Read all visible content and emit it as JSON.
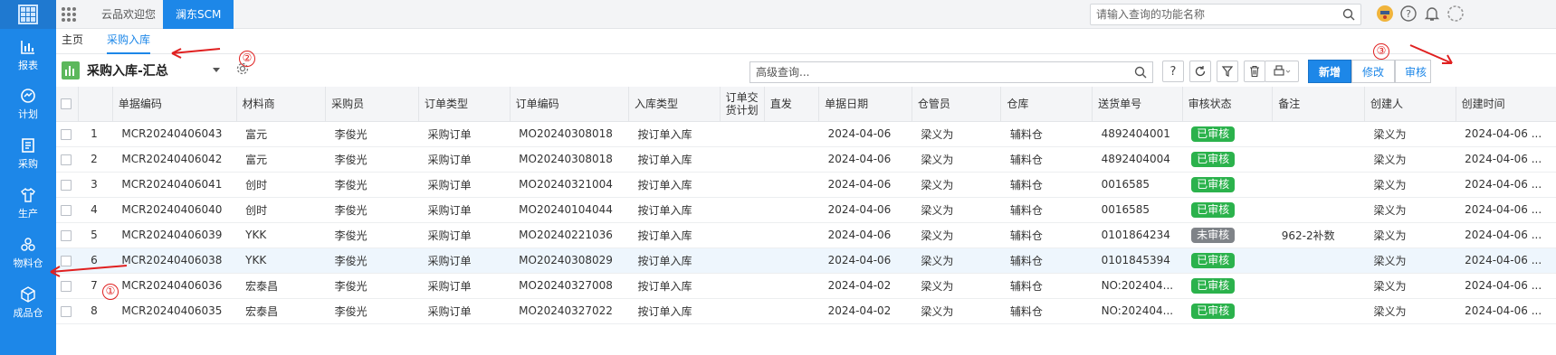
{
  "topbar": {
    "tabs": [
      "云品欢迎您",
      "澜东SCM"
    ],
    "search_placeholder": "请输入查询的功能名称",
    "icons": [
      "apps-grid-icon",
      "avatar-icon",
      "help-icon",
      "bell-icon",
      "user-loading-icon"
    ]
  },
  "sidebar": {
    "items": [
      {
        "label": "报表",
        "icon": "bar-chart-icon"
      },
      {
        "label": "计划",
        "icon": "plan-icon"
      },
      {
        "label": "采购",
        "icon": "purchase-icon"
      },
      {
        "label": "生产",
        "icon": "shirt-icon"
      },
      {
        "label": "物料仓",
        "icon": "materials-icon"
      },
      {
        "label": "成品仓",
        "icon": "box-icon"
      }
    ]
  },
  "page_tabs": [
    "主页",
    "采购入库"
  ],
  "toolbar": {
    "title": "采购入库-汇总",
    "search_placeholder": "高级查询...",
    "help_label": "?",
    "new_label": "新增",
    "edit_label": "修改",
    "audit_label": "审核"
  },
  "table": {
    "columns": [
      "单据编码",
      "材料商",
      "采购员",
      "订单类型",
      "订单编码",
      "入库类型",
      "订单交货计划",
      "直发",
      "单据日期",
      "仓管员",
      "仓库",
      "送货单号",
      "审核状态",
      "备注",
      "创建人",
      "创建时间"
    ],
    "rows": [
      {
        "no": "1",
        "code": "MCR20240406043",
        "supplier": "富元",
        "buyer": "李俊光",
        "order_type": "采购订单",
        "order_code": "MO20240308018",
        "in_type": "按订单入库",
        "plan": "",
        "direct": "",
        "date": "2024-04-06",
        "keeper": "梁义为",
        "warehouse": "辅料仓",
        "delivery": "4892404001",
        "status": "已审核",
        "status_ok": true,
        "remark": "",
        "creator": "梁义为",
        "created": "2024-04-06 ..."
      },
      {
        "no": "2",
        "code": "MCR20240406042",
        "supplier": "富元",
        "buyer": "李俊光",
        "order_type": "采购订单",
        "order_code": "MO20240308018",
        "in_type": "按订单入库",
        "plan": "",
        "direct": "",
        "date": "2024-04-06",
        "keeper": "梁义为",
        "warehouse": "辅料仓",
        "delivery": "4892404004",
        "status": "已审核",
        "status_ok": true,
        "remark": "",
        "creator": "梁义为",
        "created": "2024-04-06 ..."
      },
      {
        "no": "3",
        "code": "MCR20240406041",
        "supplier": "创时",
        "buyer": "李俊光",
        "order_type": "采购订单",
        "order_code": "MO20240321004",
        "in_type": "按订单入库",
        "plan": "",
        "direct": "",
        "date": "2024-04-06",
        "keeper": "梁义为",
        "warehouse": "辅料仓",
        "delivery": "0016585",
        "status": "已审核",
        "status_ok": true,
        "remark": "",
        "creator": "梁义为",
        "created": "2024-04-06 ..."
      },
      {
        "no": "4",
        "code": "MCR20240406040",
        "supplier": "创时",
        "buyer": "李俊光",
        "order_type": "采购订单",
        "order_code": "MO20240104044",
        "in_type": "按订单入库",
        "plan": "",
        "direct": "",
        "date": "2024-04-06",
        "keeper": "梁义为",
        "warehouse": "辅料仓",
        "delivery": "0016585",
        "status": "已审核",
        "status_ok": true,
        "remark": "",
        "creator": "梁义为",
        "created": "2024-04-06 ..."
      },
      {
        "no": "5",
        "code": "MCR20240406039",
        "supplier": "YKK",
        "buyer": "李俊光",
        "order_type": "采购订单",
        "order_code": "MO20240221036",
        "in_type": "按订单入库",
        "plan": "",
        "direct": "",
        "date": "2024-04-06",
        "keeper": "梁义为",
        "warehouse": "辅料仓",
        "delivery": "0101864234",
        "status": "未审核",
        "status_ok": false,
        "remark": "962-2补数",
        "creator": "梁义为",
        "created": "2024-04-06 ..."
      },
      {
        "no": "6",
        "code": "MCR20240406038",
        "supplier": "YKK",
        "buyer": "李俊光",
        "order_type": "采购订单",
        "order_code": "MO20240308029",
        "in_type": "按订单入库",
        "plan": "",
        "direct": "",
        "date": "2024-04-06",
        "keeper": "梁义为",
        "warehouse": "辅料仓",
        "delivery": "0101845394",
        "status": "已审核",
        "status_ok": true,
        "remark": "",
        "creator": "梁义为",
        "created": "2024-04-06 ..."
      },
      {
        "no": "7",
        "code": "MCR20240406036",
        "supplier": "宏泰昌",
        "buyer": "李俊光",
        "order_type": "采购订单",
        "order_code": "MO20240327008",
        "in_type": "按订单入库",
        "plan": "",
        "direct": "",
        "date": "2024-04-02",
        "keeper": "梁义为",
        "warehouse": "辅料仓",
        "delivery": "NO:202404...",
        "status": "已审核",
        "status_ok": true,
        "remark": "",
        "creator": "梁义为",
        "created": "2024-04-06 ..."
      },
      {
        "no": "8",
        "code": "MCR20240406035",
        "supplier": "宏泰昌",
        "buyer": "李俊光",
        "order_type": "采购订单",
        "order_code": "MO20240327022",
        "in_type": "按订单入库",
        "plan": "",
        "direct": "",
        "date": "2024-04-02",
        "keeper": "梁义为",
        "warehouse": "辅料仓",
        "delivery": "NO:202404...",
        "status": "已审核",
        "status_ok": true,
        "remark": "",
        "creator": "梁义为",
        "created": "2024-04-06 ..."
      }
    ],
    "highlight_row": 6
  },
  "annotations": [
    "①",
    "②",
    "③"
  ],
  "colors": {
    "accent": "#1d87e8",
    "approved": "#2bb24c",
    "pending": "#7f8388",
    "annotation": "#e02020"
  }
}
